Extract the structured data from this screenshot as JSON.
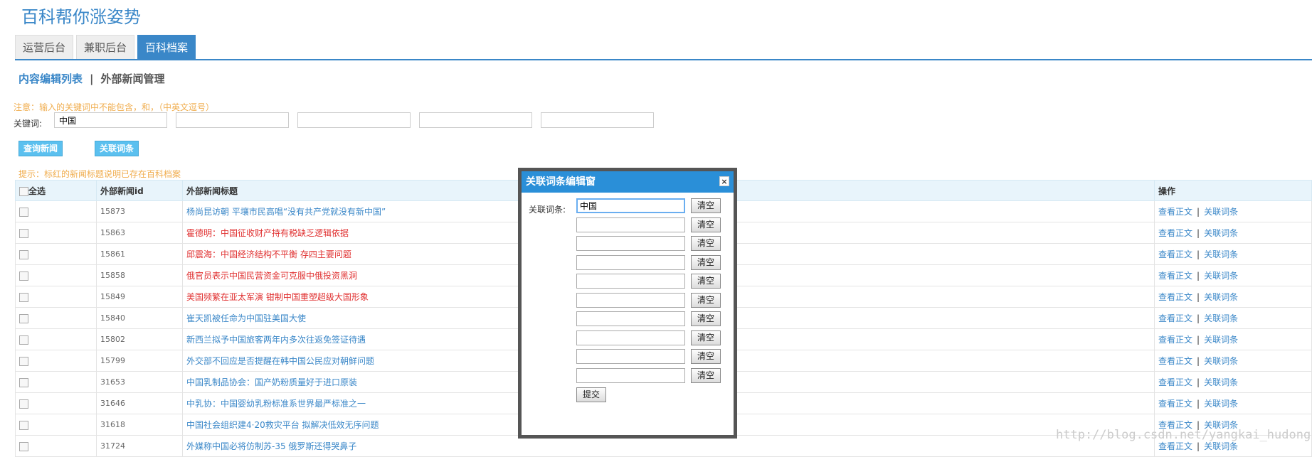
{
  "site_title": "百科帮你涨姿势",
  "tabs": [
    {
      "label": "运营后台"
    },
    {
      "label": "兼职后台"
    },
    {
      "label": "百科档案"
    }
  ],
  "subnav": {
    "active": "内容编辑列表",
    "separator": "|",
    "other": "外部新闻管理"
  },
  "notice": "注意：输入的关键词中不能包含，和，（中英文逗号）",
  "keyword": {
    "label": "关键词:",
    "values": [
      "中国",
      "",
      "",
      "",
      ""
    ]
  },
  "buttons": {
    "query": "查询新闻",
    "link": "关联词条"
  },
  "hint": "提示：标红的新闻标题说明已存在百科档案",
  "table": {
    "headers": {
      "select_all": "全选",
      "id": "外部新闻id",
      "title": "外部新闻标题",
      "ops": "操作"
    },
    "op_view": "查看正文",
    "op_sep": "|",
    "op_link": "关联词条",
    "rows": [
      {
        "id": "15873",
        "title": "杨尚昆访朝 平壤市民高唱“没有共产党就没有新中国”",
        "red": false
      },
      {
        "id": "15863",
        "title": "霍德明：中国征收财产持有税缺乏逻辑依据",
        "red": true
      },
      {
        "id": "15861",
        "title": "邱震海：中国经济结构不平衡 存四主要问题",
        "red": true
      },
      {
        "id": "15858",
        "title": "俄官员表示中国民营资金可克服中俄投资黑洞",
        "red": true
      },
      {
        "id": "15849",
        "title": "美国频繁在亚太军演 钳制中国重塑超级大国形象",
        "red": true
      },
      {
        "id": "15840",
        "title": "崔天凯被任命为中国驻美国大使",
        "red": false
      },
      {
        "id": "15802",
        "title": "新西兰拟予中国旅客两年内多次往返免签证待遇",
        "red": false
      },
      {
        "id": "15799",
        "title": "外交部不回应是否提醒在韩中国公民应对朝鲜问题",
        "red": false
      },
      {
        "id": "31653",
        "title": "中国乳制品协会：国产奶粉质量好于进口原装",
        "red": false
      },
      {
        "id": "31646",
        "title": "中乳协：中国婴幼乳粉标准系世界最严标准之一",
        "red": false
      },
      {
        "id": "31618",
        "title": "中国社会组织建4·20救灾平台 拟解决低效无序问题",
        "red": false
      },
      {
        "id": "31724",
        "title": "外媒称中国必将仿制苏-35 俄罗斯还得哭鼻子",
        "red": false
      }
    ]
  },
  "modal": {
    "title": "关联词条编辑窗",
    "close": "×",
    "label": "关联词条:",
    "values": [
      "中国",
      "",
      "",
      "",
      "",
      "",
      "",
      "",
      "",
      ""
    ],
    "clear": "清空",
    "submit": "提交"
  },
  "watermark": "http://blog.csdn.net/yangkai_hudong"
}
